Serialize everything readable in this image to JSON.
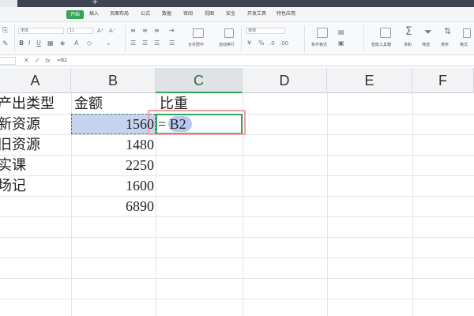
{
  "menu": {
    "items": [
      {
        "label": "开始",
        "active": true
      },
      {
        "label": "插入"
      },
      {
        "label": "页面布局"
      },
      {
        "label": "公式"
      },
      {
        "label": "数据"
      },
      {
        "label": "审阅"
      },
      {
        "label": "视图"
      },
      {
        "label": "安全"
      },
      {
        "label": "开发工具"
      },
      {
        "label": "特色应用"
      }
    ]
  },
  "ribbon": {
    "font_name": "宋体",
    "font_size": "11",
    "number_format": "常规",
    "labels": {
      "merge": "合并居中",
      "wrap": "自动换行",
      "cond_format": "条件格式",
      "smart_table": "智能工具箱",
      "sum": "求和",
      "filter": "筛选",
      "sort": "排序",
      "format": "格式"
    }
  },
  "formula_bar": {
    "formula": "=B2"
  },
  "columns": [
    "A",
    "B",
    "C",
    "D",
    "E",
    "F"
  ],
  "active_column": "C",
  "rows": [
    {
      "a": "产出类型",
      "b": "金额",
      "c": "比重"
    },
    {
      "a": "新资源",
      "b": "1560",
      "c": ""
    },
    {
      "a": "旧资源",
      "b": "1480",
      "c": ""
    },
    {
      "a": "实课",
      "b": "2250",
      "c": ""
    },
    {
      "a": "场记",
      "b": "1600",
      "c": ""
    },
    {
      "a": "",
      "b": "6890",
      "c": ""
    }
  ],
  "editing": {
    "prefix": "=",
    "reference": "B2"
  },
  "colors": {
    "accent_green": "#36a35a",
    "selection_blue": "#c7d4f0",
    "highlight_pink": "#f2a0a8"
  }
}
